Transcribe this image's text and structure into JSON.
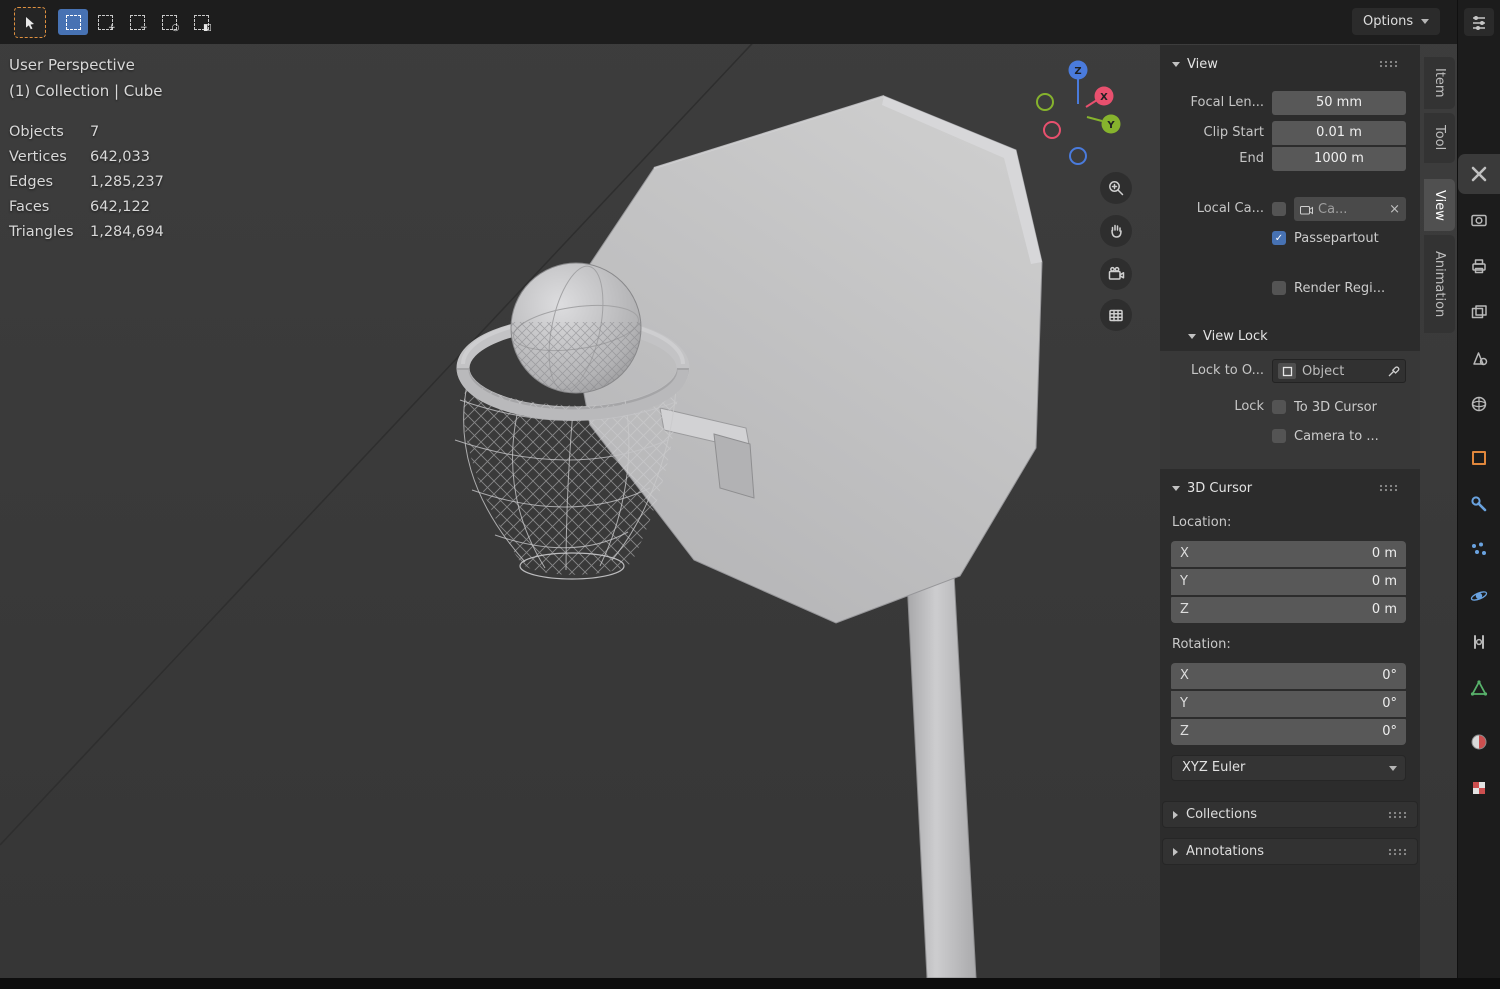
{
  "glyphs": {
    "check": "✓",
    "close": "×"
  },
  "header": {
    "active_tool": "tweak-select",
    "select_modes": [
      "set",
      "extend",
      "subtract",
      "invert",
      "intersect"
    ],
    "options_label": "Options"
  },
  "viewport": {
    "perspective_label": "User Perspective",
    "breadcrumb": "(1) Collection | Cube",
    "stats": [
      {
        "label": "Objects",
        "value": "7"
      },
      {
        "label": "Vertices",
        "value": "642,033"
      },
      {
        "label": "Edges",
        "value": "1,285,237"
      },
      {
        "label": "Faces",
        "value": "642,122"
      },
      {
        "label": "Triangles",
        "value": "1,284,694"
      }
    ],
    "gizmo_axes": [
      "X",
      "Y",
      "Z"
    ],
    "nav_buttons": [
      "zoom",
      "pan",
      "camera-view",
      "projection-toggle"
    ],
    "scene_objects": [
      "backboard",
      "pole",
      "rim",
      "net",
      "basketball",
      "bracket"
    ]
  },
  "sidebar": {
    "tabs": [
      {
        "label": "Item",
        "active": false
      },
      {
        "label": "Tool",
        "active": false
      },
      {
        "label": "View",
        "active": true
      },
      {
        "label": "Animation",
        "active": false
      }
    ],
    "view_panel": {
      "title": "View",
      "focal_label": "Focal Len...",
      "focal_value": "50 mm",
      "clip_start_label": "Clip Start",
      "clip_start_value": "0.01 m",
      "clip_end_label": "End",
      "clip_end_value": "1000 m",
      "local_camera_label": "Local Ca...",
      "local_camera_value": "Ca...",
      "passepartout_label": "Passepartout",
      "render_region_label": "Render Regi..."
    },
    "view_lock_panel": {
      "title": "View Lock",
      "lock_to_object_label": "Lock to O...",
      "lock_to_object_value": "Object",
      "lock_label": "Lock",
      "to_3d_cursor_label": "To 3D Cursor",
      "camera_to_view_label": "Camera to ..."
    },
    "cursor_panel": {
      "title": "3D Cursor",
      "location_label": "Location:",
      "location": [
        {
          "axis": "X",
          "value": "0 m"
        },
        {
          "axis": "Y",
          "value": "0 m"
        },
        {
          "axis": "Z",
          "value": "0 m"
        }
      ],
      "rotation_label": "Rotation:",
      "rotation": [
        {
          "axis": "X",
          "value": "0°"
        },
        {
          "axis": "Y",
          "value": "0°"
        },
        {
          "axis": "Z",
          "value": "0°"
        }
      ],
      "rotation_mode": "XYZ Euler"
    },
    "collections_panel": {
      "title": "Collections"
    },
    "annotations_panel": {
      "title": "Annotations"
    }
  },
  "properties_tabs": [
    "tool",
    "render",
    "output",
    "view-layer",
    "scene",
    "world",
    "object",
    "modifiers",
    "particles",
    "physics",
    "constraints",
    "object-data",
    "material",
    "texture"
  ],
  "colors": {
    "accent_blue": "#4772b3",
    "axis_x": "#e8506e",
    "axis_y": "#86b32d",
    "axis_z": "#4a7bdc",
    "object_orange": "#e0873c"
  }
}
